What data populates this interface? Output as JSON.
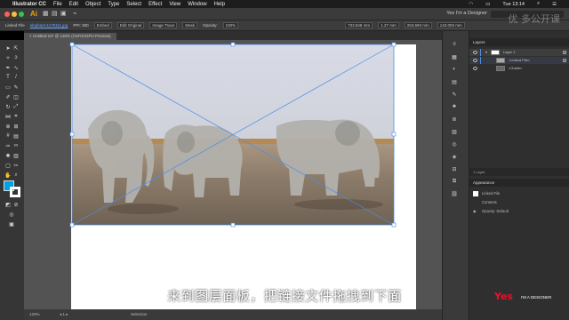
{
  "menubar": {
    "app": "Illustrator CC",
    "items": [
      "File",
      "Edit",
      "Object",
      "Type",
      "Select",
      "Effect",
      "View",
      "Window",
      "Help"
    ],
    "clock": "Tue 13:14"
  },
  "window": {
    "title": "Yes I'm a Designer"
  },
  "control": {
    "linked": "Linked File",
    "filename": "elephant-1179111.jpg",
    "ppi": "PPI: 300",
    "embed": "Embed",
    "edit_original": "Edit Original",
    "image_trace": "Image Trace",
    "mask": "Mask",
    "opacity_label": "Opacity:",
    "opacity": "100%",
    "x": "733.848 mm",
    "y": "1.27 mm",
    "w": "253.693 mm",
    "h": "143.003 mm"
  },
  "tab": {
    "label": "Untitled-10* @ 120% (CMYK/GPU Preview)"
  },
  "status": {
    "zoom": "120%",
    "page": "1",
    "mode": "Selection"
  },
  "layers_panel": {
    "title": "Layers",
    "rows": [
      {
        "name": "Layer 1"
      },
      {
        "name": "<Linked File>"
      },
      {
        "name": "<Guide>"
      }
    ],
    "footer": "1 Layer"
  },
  "appearance_panel": {
    "title": "Appearance",
    "header": "Linked File",
    "rows": [
      "Contents",
      "Opacity: Default"
    ]
  },
  "subtitle": "来到图层面板，把链接文件拖拽到下面",
  "watermark": "优 多公开课",
  "logo": {
    "mark": "Yes",
    "text": "I'M A DESIGNER"
  },
  "colors": {
    "accent": "#4a8ee6",
    "fill": "#00a0e9",
    "brand": "#e8102b"
  }
}
